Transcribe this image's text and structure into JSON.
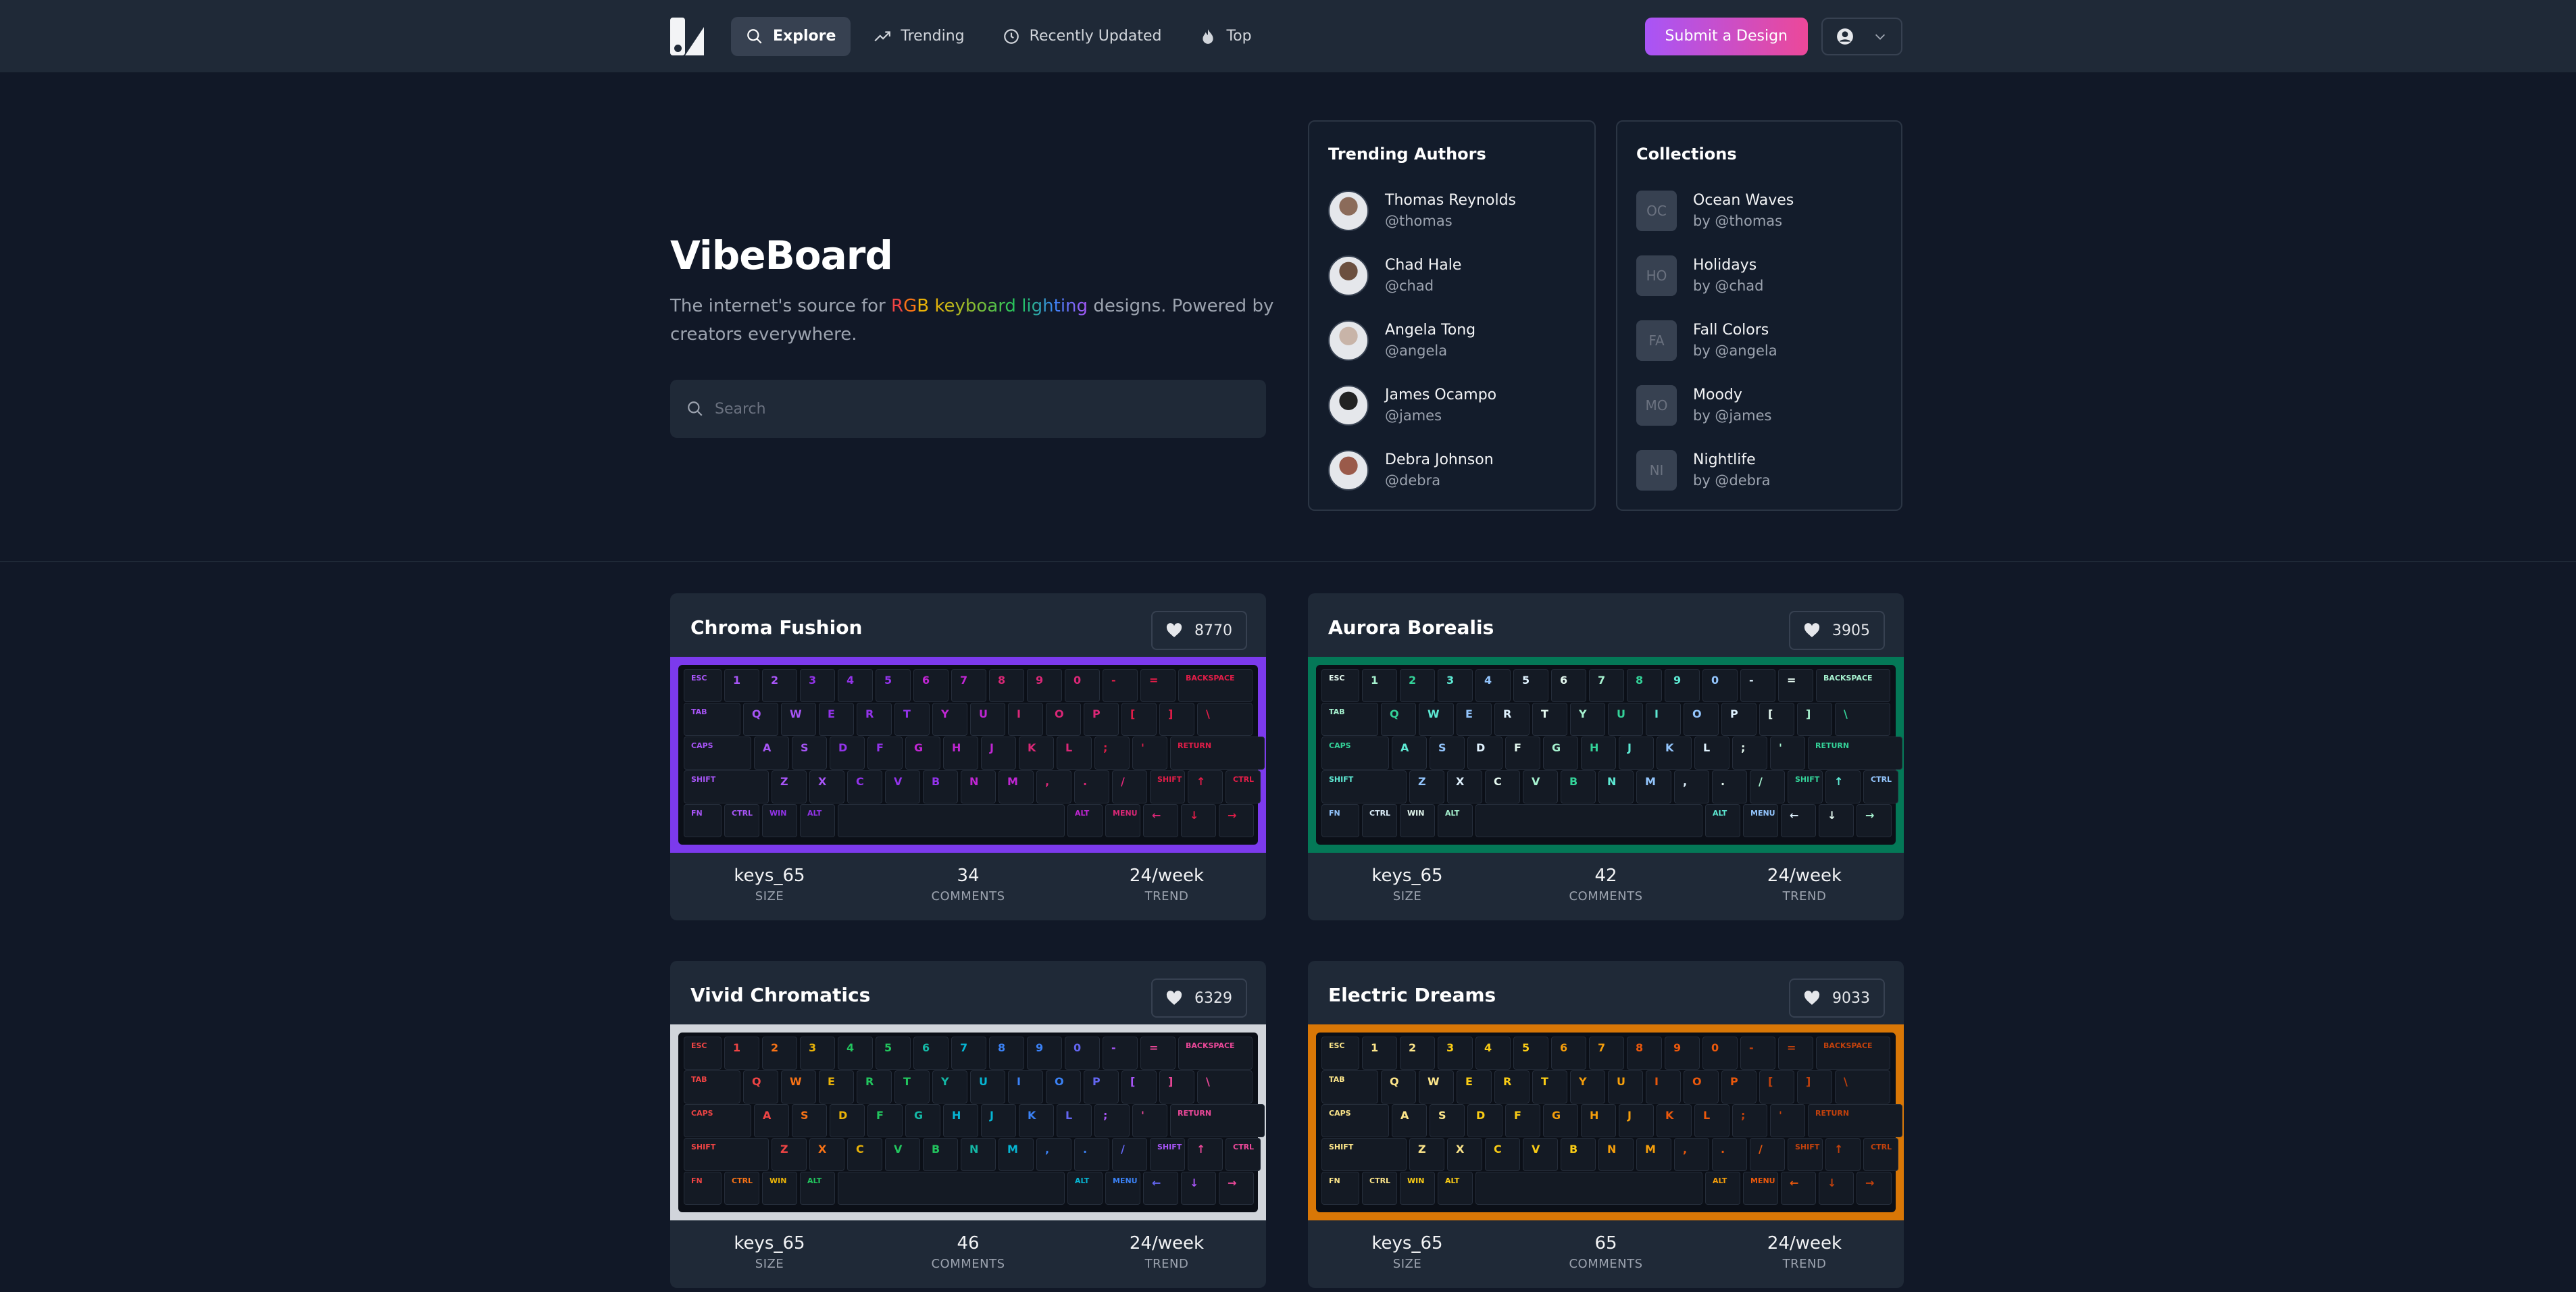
{
  "nav": {
    "items": [
      {
        "label": "Explore",
        "icon": "search-icon"
      },
      {
        "label": "Trending",
        "icon": "trending-icon"
      },
      {
        "label": "Recently Updated",
        "icon": "clock-icon"
      },
      {
        "label": "Top",
        "icon": "flame-icon"
      }
    ],
    "submit_label": "Submit a Design"
  },
  "hero": {
    "title": "VibeBoard",
    "sub_before": "The internet's source for ",
    "rgb_words": [
      "R",
      "G",
      "B",
      " ",
      "keyboard",
      " ",
      "lighting"
    ],
    "sub_after": " designs. Powered by creators everywhere.",
    "search_placeholder": "Search"
  },
  "trending": {
    "title": "Trending Authors",
    "authors": [
      {
        "name": "Thomas Reynolds",
        "handle": "@thomas",
        "color": "#8b6b5a"
      },
      {
        "name": "Chad Hale",
        "handle": "@chad",
        "color": "#6b4f3f"
      },
      {
        "name": "Angela Tong",
        "handle": "@angela",
        "color": "#c8b4a8"
      },
      {
        "name": "James Ocampo",
        "handle": "@james",
        "color": "#222222"
      },
      {
        "name": "Debra Johnson",
        "handle": "@debra",
        "color": "#9a5a4a"
      }
    ]
  },
  "collections": {
    "title": "Collections",
    "items": [
      {
        "initials": "OC",
        "name": "Ocean Waves",
        "by": "by @thomas"
      },
      {
        "initials": "HO",
        "name": "Holidays",
        "by": "by @chad"
      },
      {
        "initials": "FA",
        "name": "Fall Colors",
        "by": "by @angela"
      },
      {
        "initials": "MO",
        "name": "Moody",
        "by": "by @james"
      },
      {
        "initials": "NI",
        "name": "Nightlife",
        "by": "by @debra"
      }
    ]
  },
  "stat_labels": {
    "size": "SIZE",
    "comments": "COMMENTS",
    "trend": "TREND"
  },
  "keyboard_rows": [
    [
      "ESC",
      "1",
      "2",
      "3",
      "4",
      "5",
      "6",
      "7",
      "8",
      "9",
      "0",
      "-",
      "=",
      "BACKSPACE"
    ],
    [
      "TAB",
      "Q",
      "W",
      "E",
      "R",
      "T",
      "Y",
      "U",
      "I",
      "O",
      "P",
      "[",
      "]",
      "\\"
    ],
    [
      "CAPS",
      "A",
      "S",
      "D",
      "F",
      "G",
      "H",
      "J",
      "K",
      "L",
      ";",
      "'",
      "RETURN"
    ],
    [
      "SHIFT",
      "Z",
      "X",
      "C",
      "V",
      "B",
      "N",
      "M",
      ",",
      ".",
      "/",
      "SHIFT",
      "↑",
      "CTRL"
    ],
    [
      "FN",
      "CTRL",
      "WIN",
      "ALT",
      "",
      "ALT",
      "MENU",
      "←",
      "↓",
      "→"
    ]
  ],
  "designs": [
    {
      "title": "Chroma Fushion",
      "likes": "8770",
      "size": "keys_65",
      "comments": "34",
      "trend": "24/week",
      "border": "#7c3aed",
      "theme": "purple"
    },
    {
      "title": "Aurora Borealis",
      "likes": "3905",
      "size": "keys_65",
      "comments": "42",
      "trend": "24/week",
      "border": "#047857",
      "theme": "aurora"
    },
    {
      "title": "Vivid Chromatics",
      "likes": "6329",
      "size": "keys_65",
      "comments": "46",
      "trend": "24/week",
      "border": "#d1d5db",
      "theme": "rainbow"
    },
    {
      "title": "Electric Dreams",
      "likes": "9033",
      "size": "keys_65",
      "comments": "65",
      "trend": "24/week",
      "border": "#d97706",
      "theme": "amber"
    }
  ]
}
